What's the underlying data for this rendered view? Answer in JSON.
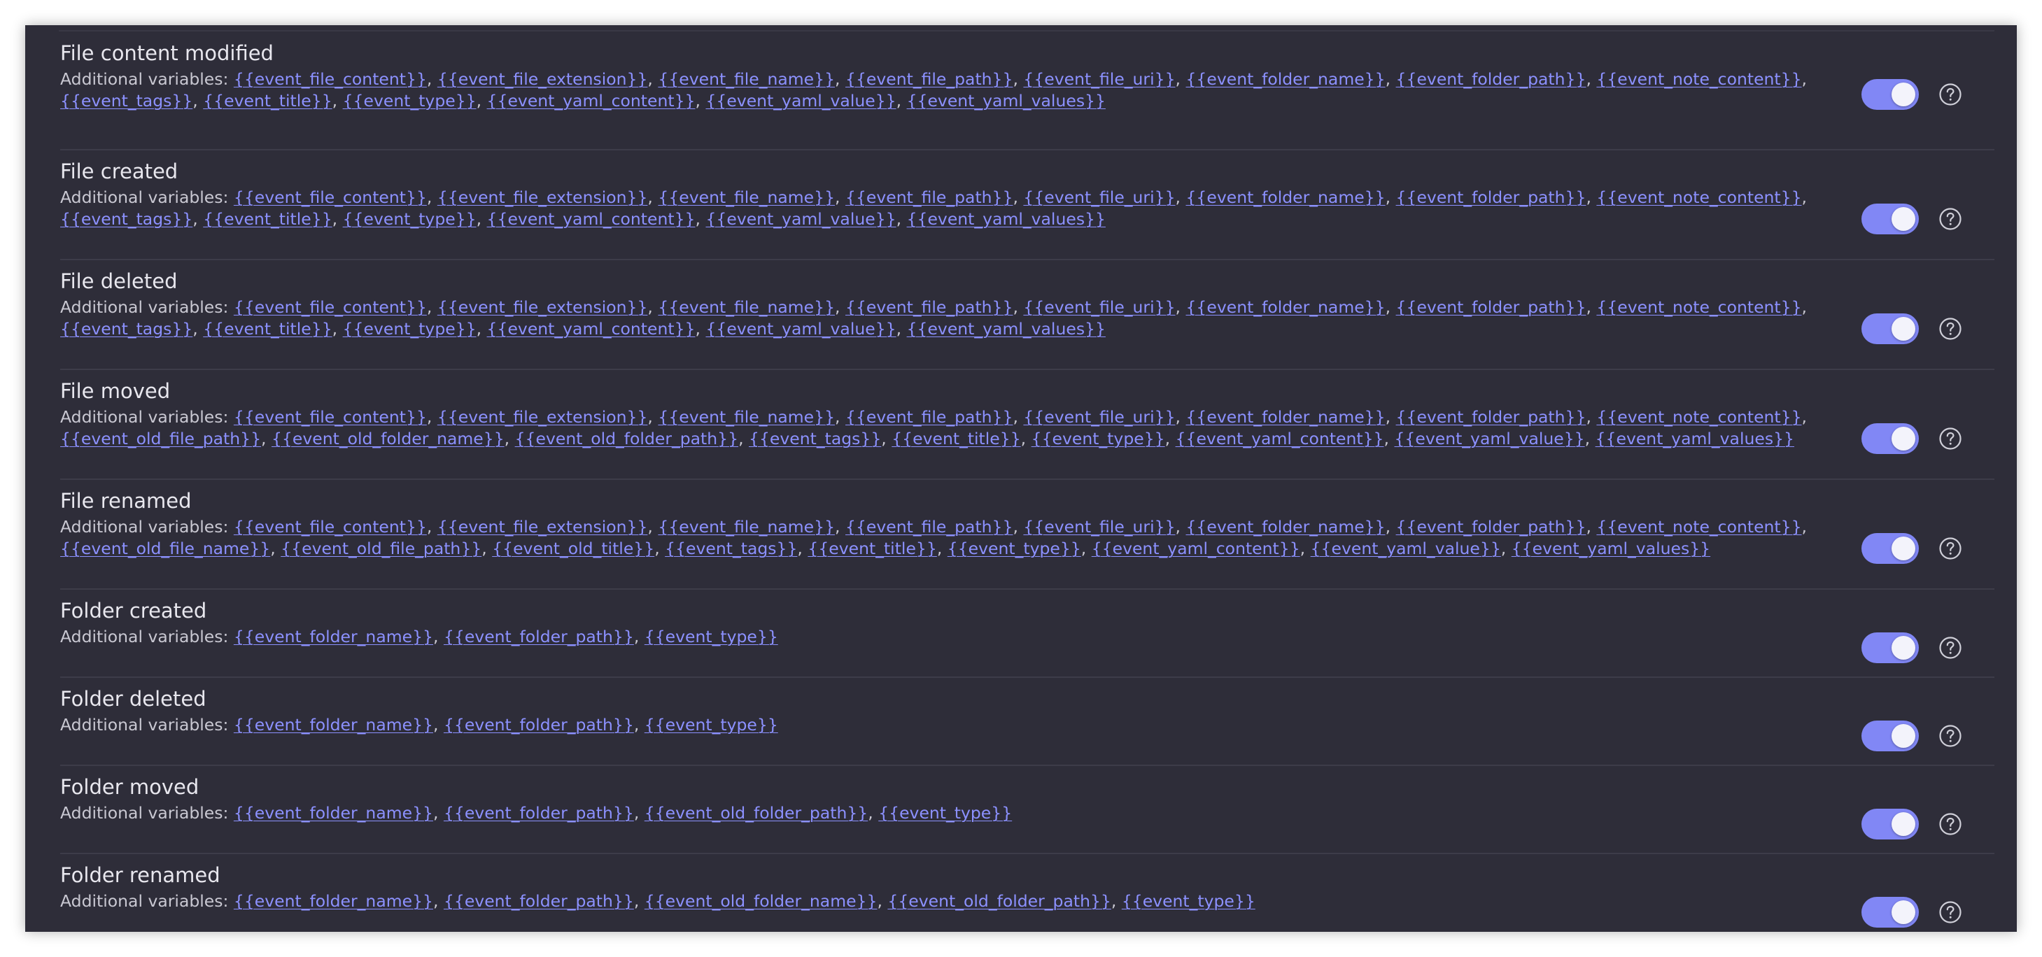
{
  "prefix": "Additional variables:",
  "settings": [
    {
      "name": "File content modified",
      "variables": [
        "{{event_file_content}}",
        "{{event_file_extension}}",
        "{{event_file_name}}",
        "{{event_file_path}}",
        "{{event_file_uri}}",
        "{{event_folder_name}}",
        "{{event_folder_path}}",
        "{{event_note_content}}",
        "{{event_tags}}",
        "{{event_title}}",
        "{{event_type}}",
        "{{event_yaml_content}}",
        "{{event_yaml_value}}",
        "{{event_yaml_values}}"
      ],
      "enabled": true
    },
    {
      "name": "File created",
      "variables": [
        "{{event_file_content}}",
        "{{event_file_extension}}",
        "{{event_file_name}}",
        "{{event_file_path}}",
        "{{event_file_uri}}",
        "{{event_folder_name}}",
        "{{event_folder_path}}",
        "{{event_note_content}}",
        "{{event_tags}}",
        "{{event_title}}",
        "{{event_type}}",
        "{{event_yaml_content}}",
        "{{event_yaml_value}}",
        "{{event_yaml_values}}"
      ],
      "enabled": true
    },
    {
      "name": "File deleted",
      "variables": [
        "{{event_file_content}}",
        "{{event_file_extension}}",
        "{{event_file_name}}",
        "{{event_file_path}}",
        "{{event_file_uri}}",
        "{{event_folder_name}}",
        "{{event_folder_path}}",
        "{{event_note_content}}",
        "{{event_tags}}",
        "{{event_title}}",
        "{{event_type}}",
        "{{event_yaml_content}}",
        "{{event_yaml_value}}",
        "{{event_yaml_values}}"
      ],
      "enabled": true
    },
    {
      "name": "File moved",
      "variables": [
        "{{event_file_content}}",
        "{{event_file_extension}}",
        "{{event_file_name}}",
        "{{event_file_path}}",
        "{{event_file_uri}}",
        "{{event_folder_name}}",
        "{{event_folder_path}}",
        "{{event_note_content}}",
        "{{event_old_file_path}}",
        "{{event_old_folder_name}}",
        "{{event_old_folder_path}}",
        "{{event_tags}}",
        "{{event_title}}",
        "{{event_type}}",
        "{{event_yaml_content}}",
        "{{event_yaml_value}}",
        "{{event_yaml_values}}"
      ],
      "enabled": true
    },
    {
      "name": "File renamed",
      "variables": [
        "{{event_file_content}}",
        "{{event_file_extension}}",
        "{{event_file_name}}",
        "{{event_file_path}}",
        "{{event_file_uri}}",
        "{{event_folder_name}}",
        "{{event_folder_path}}",
        "{{event_note_content}}",
        "{{event_old_file_name}}",
        "{{event_old_file_path}}",
        "{{event_old_title}}",
        "{{event_tags}}",
        "{{event_title}}",
        "{{event_type}}",
        "{{event_yaml_content}}",
        "{{event_yaml_value}}",
        "{{event_yaml_values}}"
      ],
      "enabled": true
    },
    {
      "name": "Folder created",
      "variables": [
        "{{event_folder_name}}",
        "{{event_folder_path}}",
        "{{event_type}}"
      ],
      "enabled": true
    },
    {
      "name": "Folder deleted",
      "variables": [
        "{{event_folder_name}}",
        "{{event_folder_path}}",
        "{{event_type}}"
      ],
      "enabled": true
    },
    {
      "name": "Folder moved",
      "variables": [
        "{{event_folder_name}}",
        "{{event_folder_path}}",
        "{{event_old_folder_path}}",
        "{{event_type}}"
      ],
      "enabled": true
    },
    {
      "name": "Folder renamed",
      "variables": [
        "{{event_folder_name}}",
        "{{event_folder_path}}",
        "{{event_old_folder_name}}",
        "{{event_old_folder_path}}",
        "{{event_type}}"
      ],
      "enabled": true
    }
  ],
  "colors": {
    "background": "#2e2d39",
    "accent": "#8187f5",
    "link": "#8c91ff",
    "title_text": "#e8e7ee",
    "desc_text": "#c9c8d2"
  },
  "icons": {
    "help": "question-circle-icon"
  }
}
